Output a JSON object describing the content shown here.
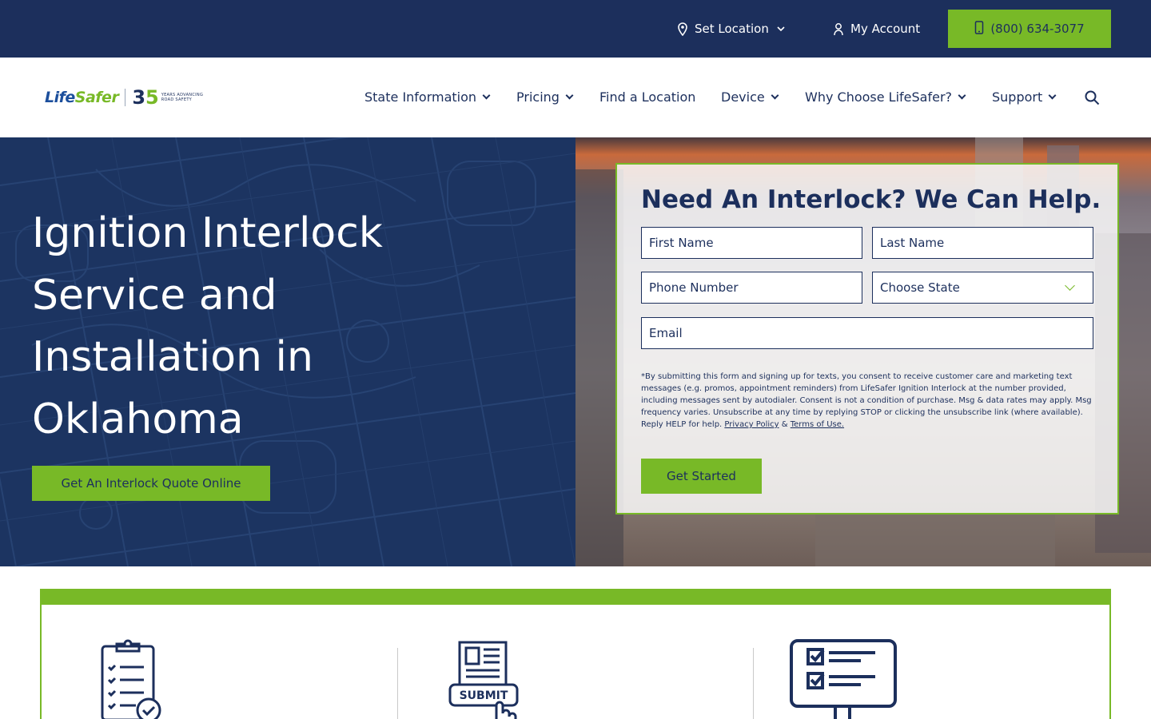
{
  "topbar": {
    "set_location": "Set Location",
    "my_account": "My Account",
    "phone": "(800) 634-3077"
  },
  "logo": {
    "word_a": "Life",
    "word_b": "Safer",
    "anniversary_3": "3",
    "anniversary_5": "5",
    "tagline": "YEARS ADVANCING ROAD SAFETY"
  },
  "nav": {
    "items": [
      {
        "label": "State Information",
        "has_dropdown": true
      },
      {
        "label": "Pricing",
        "has_dropdown": true
      },
      {
        "label": "Find a Location",
        "has_dropdown": false
      },
      {
        "label": "Device",
        "has_dropdown": true
      },
      {
        "label": "Why Choose LifeSafer?",
        "has_dropdown": true
      },
      {
        "label": "Support",
        "has_dropdown": true
      }
    ]
  },
  "hero": {
    "title": "Ignition Interlock Service and Installation in Oklahoma",
    "cta": "Get An Interlock Quote Online"
  },
  "form": {
    "title": "Need An Interlock? We Can Help.",
    "first_name_placeholder": "First Name",
    "last_name_placeholder": "Last Name",
    "phone_placeholder": "Phone Number",
    "state_selected": "Choose State",
    "email_placeholder": "Email",
    "disclaimer": "*By submitting this form and signing up for texts, you consent to receive customer care and marketing text messages (e.g. promos, appointment reminders) from LifeSafer Ignition Interlock at the number provided, including messages sent by autodialer. Consent is not a condition of purchase. Msg & data rates may apply. Msg frequency varies. Unsubscribe at any time by replying STOP or clicking the unsubscribe link (where available). Reply HELP for help.",
    "privacy_link": "Privacy Policy",
    "amp": "&",
    "terms_link": "Terms of Use.",
    "submit": "Get Started"
  },
  "steps": {
    "submit_icon_text": "SUBMIT"
  },
  "colors": {
    "navy": "#1c2f5c",
    "green": "#78b927",
    "hero_navy": "#1c3461"
  },
  "icons": [
    "map-marker-icon",
    "chevron-down-icon",
    "user-icon",
    "phone-icon",
    "search-icon",
    "clipboard-checklist-icon",
    "submit-form-icon",
    "checklist-board-icon"
  ]
}
